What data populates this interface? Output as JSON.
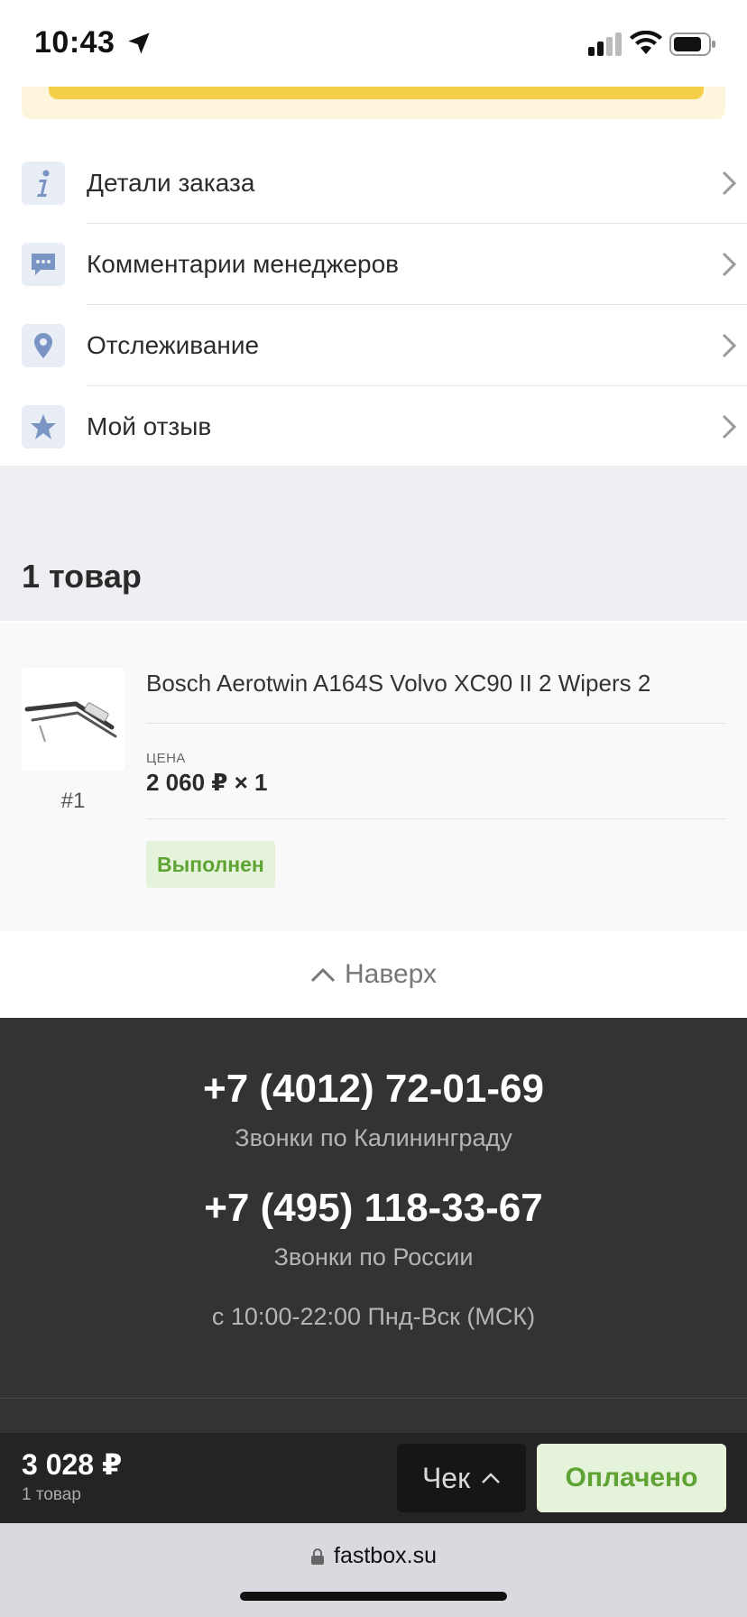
{
  "status_bar": {
    "time": "10:43"
  },
  "menu": {
    "items": [
      {
        "label": "Детали заказа",
        "icon": "info-icon"
      },
      {
        "label": "Комментарии менеджеров",
        "icon": "chat-icon"
      },
      {
        "label": "Отслеживание",
        "icon": "location-pin-icon"
      },
      {
        "label": "Мой отзыв",
        "icon": "star-icon"
      }
    ]
  },
  "items_section": {
    "heading": "1 товар"
  },
  "product": {
    "index": "#1",
    "title": "Bosch Aerotwin A164S Volvo XC90 II 2 Wipers 2",
    "price_label": "ЦЕНА",
    "price_value": "2 060 ₽ × 1",
    "status": "Выполнен"
  },
  "scroll_top": {
    "label": "Наверх"
  },
  "footer": {
    "phone_local": "+7 (4012) 72-01-69",
    "phone_local_caption": "Звонки по Калининграду",
    "phone_russia": "+7 (495) 118-33-67",
    "phone_russia_caption": "Звонки по России",
    "hours": "с 10:00-22:00 Пнд-Вск (МСК)"
  },
  "bottom_bar": {
    "total": "3 028 ₽",
    "count": "1 товар",
    "receipt_label": "Чек",
    "paid_label": "Оплачено"
  },
  "browser": {
    "url": "fastbox.su"
  },
  "colors": {
    "accent_green": "#5ea334",
    "badge_bg": "#e5f3da",
    "banner_yellow": "#f5cf4a",
    "footer_bg": "#333333",
    "icon_blue": "#7a95c4"
  }
}
